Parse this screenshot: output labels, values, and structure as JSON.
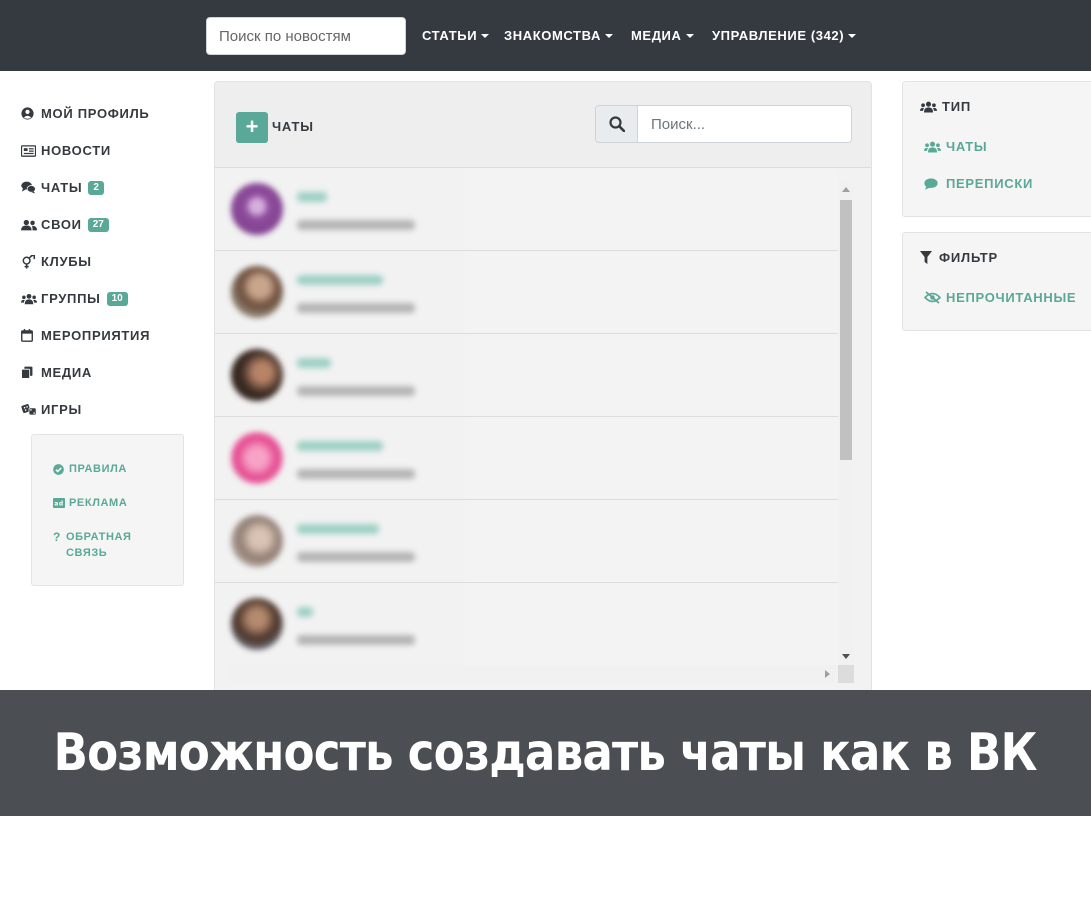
{
  "navbar": {
    "search_placeholder": "Поиск по новостям",
    "items": [
      {
        "label": "СТАТЬИ"
      },
      {
        "label": "ЗНАКОМСТВА"
      },
      {
        "label": "МЕДИА"
      },
      {
        "label": "УПРАВЛЕНИЕ (342)"
      }
    ]
  },
  "sidebar": {
    "items": [
      {
        "label": "МОЙ ПРОФИЛЬ",
        "icon": "user-circle-icon"
      },
      {
        "label": "НОВОСТИ",
        "icon": "newspaper-icon"
      },
      {
        "label": "ЧАТЫ",
        "icon": "comments-icon",
        "badge": "2"
      },
      {
        "label": "СВОИ",
        "icon": "user-friends-icon",
        "badge": "27"
      },
      {
        "label": "КЛУБЫ",
        "icon": "gender-icon"
      },
      {
        "label": "ГРУППЫ",
        "icon": "users-icon",
        "badge": "10"
      },
      {
        "label": "МЕРОПРИЯТИЯ",
        "icon": "calendar-icon"
      },
      {
        "label": "МЕДИА",
        "icon": "copy-icon"
      },
      {
        "label": "ИГРЫ",
        "icon": "dice-icon"
      }
    ],
    "info": [
      {
        "label": "ПРАВИЛА",
        "icon": "check-circle-icon"
      },
      {
        "label": "РЕКЛАМА",
        "icon": "ad-icon"
      },
      {
        "label": "ОБРАТНАЯ СВЯЗЬ",
        "icon": "question-icon"
      }
    ]
  },
  "chats": {
    "title": "ЧАТЫ",
    "add_label": "+",
    "search_placeholder": "Поиск..."
  },
  "type_panel": {
    "title": "ТИП",
    "links": [
      {
        "label": "ЧАТЫ"
      },
      {
        "label": "ПЕРЕПИСКИ"
      }
    ]
  },
  "filter_panel": {
    "title": "ФИЛЬТР",
    "links": [
      {
        "label": "НЕПРОЧИТАННЫЕ"
      }
    ]
  },
  "banner": {
    "text": "Возможность создавать чаты как в ВК"
  },
  "colors": {
    "navbar": "#343a40",
    "accent": "#5aa897",
    "banner": "#4b4f54"
  }
}
